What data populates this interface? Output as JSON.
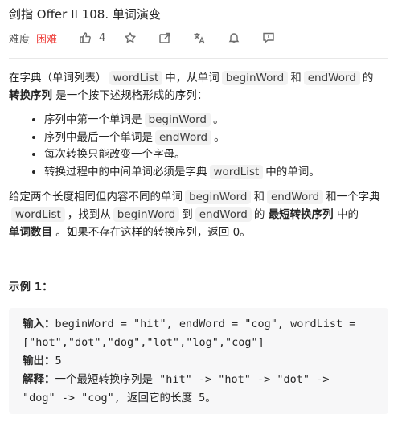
{
  "title": "剑指 Offer II 108. 单词演变",
  "meta": {
    "difficulty_label": "难度",
    "difficulty": "困难",
    "difficulty_color": "#ef4743",
    "likes": "4",
    "icons": [
      "thumbs-up-icon",
      "star-icon",
      "share-icon",
      "translate-icon",
      "bell-icon",
      "feedback-icon"
    ]
  },
  "description": {
    "intro_1": "在字典（单词列表）",
    "intro_code": "wordList",
    "intro_2": "中，从单词",
    "intro_code2": "beginWord",
    "intro_3": "和",
    "intro_code3": "endWord",
    "intro_4": "的",
    "intro_bold": "转换序列",
    "intro_5": "是一个按下述规格形成的序列：",
    "bullets": [
      {
        "pre": "序列中第一个单词是",
        "code": "beginWord",
        "post": "。"
      },
      {
        "pre": "序列中最后一个单词是",
        "code": "endWord",
        "post": "。"
      },
      {
        "pre": "每次转换只能改变一个字母。",
        "code": "",
        "post": ""
      },
      {
        "pre": "转换过程中的中间单词必须是字典",
        "code": "wordList",
        "post": "中的单词。"
      }
    ],
    "task_1": "给定两个长度相同但内容不同的单词",
    "task_code1": "beginWord",
    "task_2": "和",
    "task_code2": "endWord",
    "task_3": "和一个字典",
    "task_code3": "wordList",
    "task_4": "，找到从",
    "task_code4": "beginWord",
    "task_5": "到",
    "task_code5": "endWord",
    "task_6": "的",
    "task_bold1": "最短转换序列",
    "task_7": "中的",
    "task_bold2": "单词数目",
    "task_8": "。如果不存在这样的转换序列，返回 0。"
  },
  "example": {
    "title": "示例 1：",
    "input_label": "输入：",
    "input_line1": "beginWord = \"hit\", endWord = \"cog\", wordList =",
    "input_line2": "[\"hot\",\"dot\",\"dog\",\"lot\",\"log\",\"cog\"]",
    "output_label": "输出：",
    "output_value": "5",
    "explain_label": "解释：",
    "explain_line1": "一个最短转换序列是 \"hit\" -> \"hot\" -> \"dot\" ->",
    "explain_line2": "\"dog\" -> \"cog\", 返回它的长度 5。"
  }
}
